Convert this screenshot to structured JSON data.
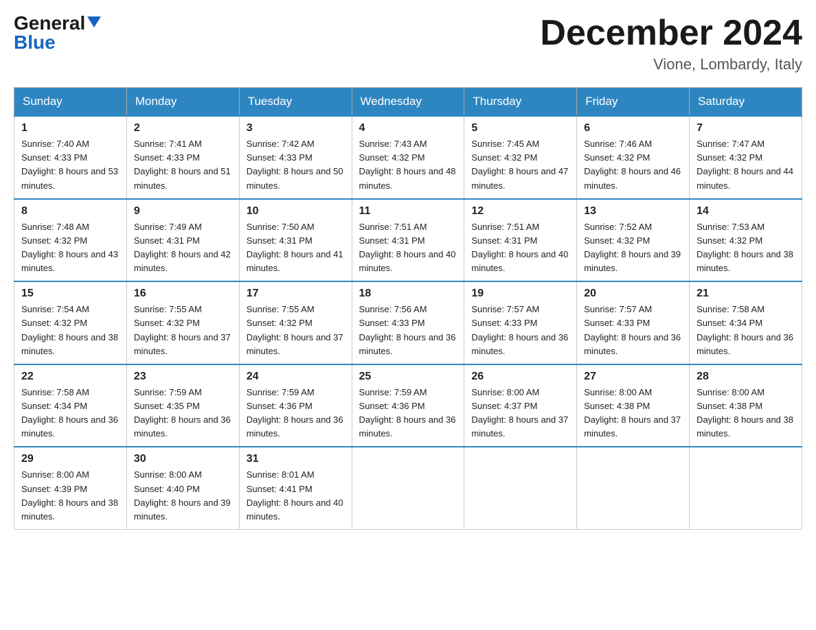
{
  "header": {
    "logo_general": "General",
    "logo_blue": "Blue",
    "month_title": "December 2024",
    "location": "Vione, Lombardy, Italy"
  },
  "weekdays": [
    "Sunday",
    "Monday",
    "Tuesday",
    "Wednesday",
    "Thursday",
    "Friday",
    "Saturday"
  ],
  "weeks": [
    [
      {
        "day": "1",
        "sunrise": "7:40 AM",
        "sunset": "4:33 PM",
        "daylight": "8 hours and 53 minutes."
      },
      {
        "day": "2",
        "sunrise": "7:41 AM",
        "sunset": "4:33 PM",
        "daylight": "8 hours and 51 minutes."
      },
      {
        "day": "3",
        "sunrise": "7:42 AM",
        "sunset": "4:33 PM",
        "daylight": "8 hours and 50 minutes."
      },
      {
        "day": "4",
        "sunrise": "7:43 AM",
        "sunset": "4:32 PM",
        "daylight": "8 hours and 48 minutes."
      },
      {
        "day": "5",
        "sunrise": "7:45 AM",
        "sunset": "4:32 PM",
        "daylight": "8 hours and 47 minutes."
      },
      {
        "day": "6",
        "sunrise": "7:46 AM",
        "sunset": "4:32 PM",
        "daylight": "8 hours and 46 minutes."
      },
      {
        "day": "7",
        "sunrise": "7:47 AM",
        "sunset": "4:32 PM",
        "daylight": "8 hours and 44 minutes."
      }
    ],
    [
      {
        "day": "8",
        "sunrise": "7:48 AM",
        "sunset": "4:32 PM",
        "daylight": "8 hours and 43 minutes."
      },
      {
        "day": "9",
        "sunrise": "7:49 AM",
        "sunset": "4:31 PM",
        "daylight": "8 hours and 42 minutes."
      },
      {
        "day": "10",
        "sunrise": "7:50 AM",
        "sunset": "4:31 PM",
        "daylight": "8 hours and 41 minutes."
      },
      {
        "day": "11",
        "sunrise": "7:51 AM",
        "sunset": "4:31 PM",
        "daylight": "8 hours and 40 minutes."
      },
      {
        "day": "12",
        "sunrise": "7:51 AM",
        "sunset": "4:31 PM",
        "daylight": "8 hours and 40 minutes."
      },
      {
        "day": "13",
        "sunrise": "7:52 AM",
        "sunset": "4:32 PM",
        "daylight": "8 hours and 39 minutes."
      },
      {
        "day": "14",
        "sunrise": "7:53 AM",
        "sunset": "4:32 PM",
        "daylight": "8 hours and 38 minutes."
      }
    ],
    [
      {
        "day": "15",
        "sunrise": "7:54 AM",
        "sunset": "4:32 PM",
        "daylight": "8 hours and 38 minutes."
      },
      {
        "day": "16",
        "sunrise": "7:55 AM",
        "sunset": "4:32 PM",
        "daylight": "8 hours and 37 minutes."
      },
      {
        "day": "17",
        "sunrise": "7:55 AM",
        "sunset": "4:32 PM",
        "daylight": "8 hours and 37 minutes."
      },
      {
        "day": "18",
        "sunrise": "7:56 AM",
        "sunset": "4:33 PM",
        "daylight": "8 hours and 36 minutes."
      },
      {
        "day": "19",
        "sunrise": "7:57 AM",
        "sunset": "4:33 PM",
        "daylight": "8 hours and 36 minutes."
      },
      {
        "day": "20",
        "sunrise": "7:57 AM",
        "sunset": "4:33 PM",
        "daylight": "8 hours and 36 minutes."
      },
      {
        "day": "21",
        "sunrise": "7:58 AM",
        "sunset": "4:34 PM",
        "daylight": "8 hours and 36 minutes."
      }
    ],
    [
      {
        "day": "22",
        "sunrise": "7:58 AM",
        "sunset": "4:34 PM",
        "daylight": "8 hours and 36 minutes."
      },
      {
        "day": "23",
        "sunrise": "7:59 AM",
        "sunset": "4:35 PM",
        "daylight": "8 hours and 36 minutes."
      },
      {
        "day": "24",
        "sunrise": "7:59 AM",
        "sunset": "4:36 PM",
        "daylight": "8 hours and 36 minutes."
      },
      {
        "day": "25",
        "sunrise": "7:59 AM",
        "sunset": "4:36 PM",
        "daylight": "8 hours and 36 minutes."
      },
      {
        "day": "26",
        "sunrise": "8:00 AM",
        "sunset": "4:37 PM",
        "daylight": "8 hours and 37 minutes."
      },
      {
        "day": "27",
        "sunrise": "8:00 AM",
        "sunset": "4:38 PM",
        "daylight": "8 hours and 37 minutes."
      },
      {
        "day": "28",
        "sunrise": "8:00 AM",
        "sunset": "4:38 PM",
        "daylight": "8 hours and 38 minutes."
      }
    ],
    [
      {
        "day": "29",
        "sunrise": "8:00 AM",
        "sunset": "4:39 PM",
        "daylight": "8 hours and 38 minutes."
      },
      {
        "day": "30",
        "sunrise": "8:00 AM",
        "sunset": "4:40 PM",
        "daylight": "8 hours and 39 minutes."
      },
      {
        "day": "31",
        "sunrise": "8:01 AM",
        "sunset": "4:41 PM",
        "daylight": "8 hours and 40 minutes."
      },
      null,
      null,
      null,
      null
    ]
  ],
  "labels": {
    "sunrise": "Sunrise: ",
    "sunset": "Sunset: ",
    "daylight": "Daylight: "
  }
}
